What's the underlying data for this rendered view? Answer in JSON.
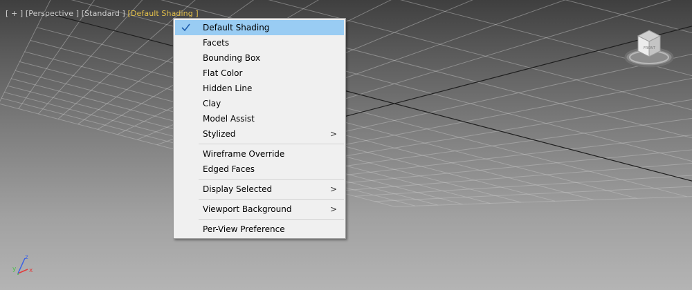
{
  "viewport": {
    "labels": [
      "[ + ]",
      "[Perspective ]",
      "[Standard ]",
      "[Default Shading ]"
    ],
    "active_label": "[Default Shading ]"
  },
  "menu": {
    "items": [
      {
        "label": "Default Shading",
        "checked": true,
        "highlighted": true
      },
      {
        "label": "Facets"
      },
      {
        "label": "Bounding Box"
      },
      {
        "label": "Flat Color"
      },
      {
        "label": "Hidden Line"
      },
      {
        "label": "Clay"
      },
      {
        "label": "Model Assist"
      },
      {
        "label": "Stylized",
        "submenu": true
      },
      {
        "label": "Wireframe Override"
      },
      {
        "label": "Edged Faces"
      },
      {
        "label": "Display Selected",
        "submenu": true
      },
      {
        "label": "Viewport Background",
        "submenu": true
      },
      {
        "label": "Per-View Preference"
      }
    ],
    "submenu_arrow": ">"
  },
  "viewcube": {
    "face_label": "FRONT"
  },
  "gizmo": {
    "x": "x",
    "y": "y",
    "z": "z"
  },
  "colors": {
    "menu_highlight": "#99ccf3",
    "active_label": "#e4c14a",
    "axis_x": "#e23a3a",
    "axis_y": "#4bbf4b",
    "axis_z": "#3a62e6"
  }
}
